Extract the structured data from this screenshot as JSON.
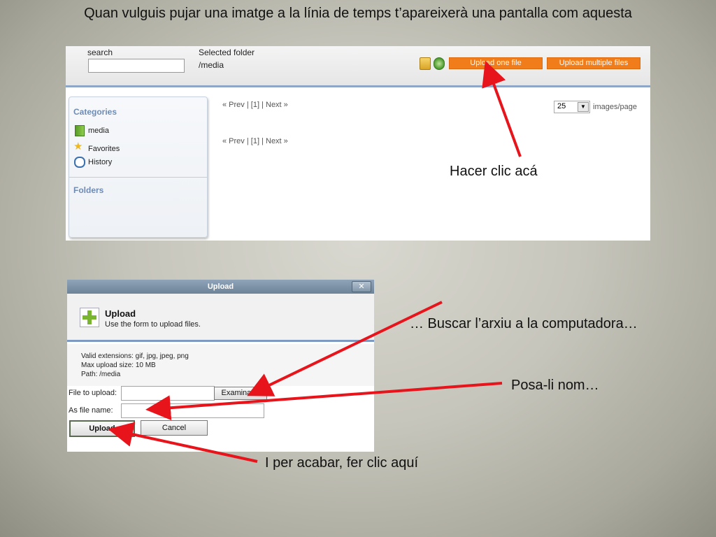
{
  "slide": {
    "title": "Quan vulguis pujar una imatge a la línia de temps t’apareixerà una pantalla com aquesta",
    "annotations": {
      "upload_click": "Hacer clic acá",
      "browse_file": "… Buscar l’arxiu a la computadora…",
      "set_name": "Posa-li nom…",
      "finish": "I per acabar, fer clic aquí"
    },
    "arrow_color": "#e8141c"
  },
  "media_browser": {
    "search_label": "search",
    "search_value": "",
    "selected_folder_label": "Selected folder",
    "selected_folder_path": "/media",
    "toolbar_icons": [
      "new-folder-icon",
      "refresh-icon"
    ],
    "upload_one_label": "Upload one file",
    "upload_multiple_label": "Upload multiple files",
    "button_color": "#f07c1a",
    "sidebar": {
      "categories_heading": "Categories",
      "items": [
        {
          "label": "media",
          "icon": "folder-icon"
        },
        {
          "label": "Favorites",
          "icon": "star-icon"
        },
        {
          "label": "History",
          "icon": "clock-icon"
        }
      ],
      "folders_heading": "Folders"
    },
    "pager": {
      "prev": "« Prev",
      "sep": "|",
      "page": "[1]",
      "next": "Next »"
    },
    "per_page_value": "25",
    "per_page_label": "images/page"
  },
  "upload_dialog": {
    "title": "Upload",
    "heading": "Upload",
    "subheading": "Use the form to upload files.",
    "valid_extensions": "Valid extensions: gif, jpg, jpeg, png",
    "max_size": "Max upload size: 10 MB",
    "path": "Path: /media",
    "file_label": "File to upload:",
    "file_value": "",
    "browse_label": "Examinar...",
    "name_label": "As file name:",
    "name_value": "",
    "upload_button": "Upload",
    "cancel_button": "Cancel"
  }
}
